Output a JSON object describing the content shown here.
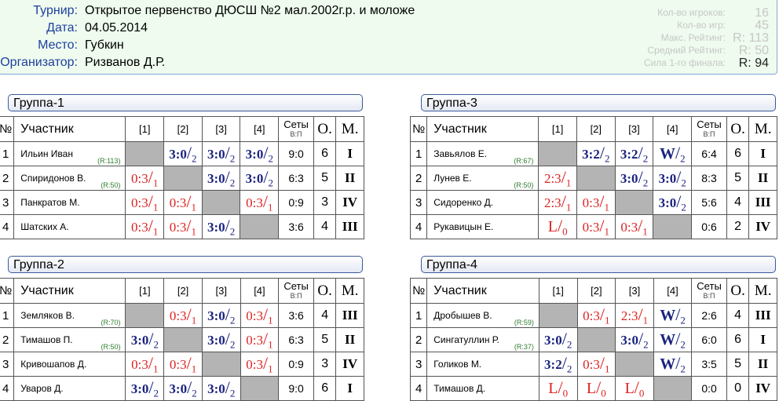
{
  "header": {
    "tournament_label": "Турнир:",
    "tournament": "Открытое первенство ДЮСШ №2 мал.2002г.р. и моложе",
    "date_label": "Дата:",
    "date": "04.05.2014",
    "place_label": "Место:",
    "place": "Губкин",
    "organizer_label": "Организатор:",
    "organizer": "Ризванов Д.Р."
  },
  "stats": {
    "players_label": "Кол-во игроков:",
    "players": "16",
    "games_label": "Кол-во игр:",
    "games": "45",
    "max_rating_label": "Макс. Рейтинг:",
    "max_rating": "R: 113",
    "avg_rating_label": "Средний Рейтинг:",
    "avg_rating": "R:  50",
    "final_strength_label": "Сила 1-го финала:",
    "final_strength": "R:  94"
  },
  "columns": {
    "num": "№",
    "participant": "Участник",
    "c1": "[1]",
    "c2": "[2]",
    "c3": "[3]",
    "c4": "[4]",
    "sets": "Сеты",
    "sets_sub": "В:П",
    "points": "О.",
    "place": "М."
  },
  "groups": [
    {
      "title": "Группа-1",
      "rows": [
        {
          "n": "1",
          "name": "Ильин Иван",
          "rating": "(R:113)",
          "r": [
            null,
            {
              "s": "3:0",
              "p": "2",
              "w": true
            },
            {
              "s": "3:0",
              "p": "2",
              "w": true
            },
            {
              "s": "3:0",
              "p": "2",
              "w": true
            }
          ],
          "sets": "9:0",
          "pts": "6",
          "place": "I"
        },
        {
          "n": "2",
          "name": "Спиридонов В.",
          "rating": "(R:50)",
          "r": [
            {
              "s": "0:3",
              "p": "1",
              "w": false
            },
            null,
            {
              "s": "3:0",
              "p": "2",
              "w": true
            },
            {
              "s": "3:0",
              "p": "2",
              "w": true
            }
          ],
          "sets": "6:3",
          "pts": "5",
          "place": "II"
        },
        {
          "n": "3",
          "name": "Панкратов М.",
          "rating": "",
          "r": [
            {
              "s": "0:3",
              "p": "1",
              "w": false
            },
            {
              "s": "0:3",
              "p": "1",
              "w": false
            },
            null,
            {
              "s": "0:3",
              "p": "1",
              "w": false
            }
          ],
          "sets": "0:9",
          "pts": "3",
          "place": "IV"
        },
        {
          "n": "4",
          "name": "Шатских А.",
          "rating": "",
          "r": [
            {
              "s": "0:3",
              "p": "1",
              "w": false
            },
            {
              "s": "0:3",
              "p": "1",
              "w": false
            },
            {
              "s": "3:0",
              "p": "2",
              "w": true
            },
            null
          ],
          "sets": "3:6",
          "pts": "4",
          "place": "III"
        }
      ]
    },
    {
      "title": "Группа-3",
      "rows": [
        {
          "n": "1",
          "name": "Завьялов Е.",
          "rating": "(R:67)",
          "r": [
            null,
            {
              "s": "3:2",
              "p": "2",
              "w": true
            },
            {
              "s": "3:2",
              "p": "2",
              "w": true
            },
            {
              "s": "W",
              "p": "2",
              "w": true
            }
          ],
          "sets": "6:4",
          "pts": "6",
          "place": "I"
        },
        {
          "n": "2",
          "name": "Лунев Е.",
          "rating": "(R:50)",
          "r": [
            {
              "s": "2:3",
              "p": "1",
              "w": false
            },
            null,
            {
              "s": "3:0",
              "p": "2",
              "w": true
            },
            {
              "s": "3:0",
              "p": "2",
              "w": true
            }
          ],
          "sets": "8:3",
          "pts": "5",
          "place": "II"
        },
        {
          "n": "3",
          "name": "Сидоренко Д.",
          "rating": "",
          "r": [
            {
              "s": "2:3",
              "p": "1",
              "w": false
            },
            {
              "s": "0:3",
              "p": "1",
              "w": false
            },
            null,
            {
              "s": "3:0",
              "p": "2",
              "w": true
            }
          ],
          "sets": "5:6",
          "pts": "4",
          "place": "III"
        },
        {
          "n": "4",
          "name": "Рукавицын Е.",
          "rating": "",
          "r": [
            {
              "s": "L",
              "p": "0",
              "w": false
            },
            {
              "s": "0:3",
              "p": "1",
              "w": false
            },
            {
              "s": "0:3",
              "p": "1",
              "w": false
            },
            null
          ],
          "sets": "0:6",
          "pts": "2",
          "place": "IV"
        }
      ]
    },
    {
      "title": "Группа-2",
      "rows": [
        {
          "n": "1",
          "name": "Земляков В.",
          "rating": "(R:70)",
          "r": [
            null,
            {
              "s": "0:3",
              "p": "1",
              "w": false
            },
            {
              "s": "3:0",
              "p": "2",
              "w": true
            },
            {
              "s": "0:3",
              "p": "1",
              "w": false
            }
          ],
          "sets": "3:6",
          "pts": "4",
          "place": "III"
        },
        {
          "n": "2",
          "name": "Тимашов П.",
          "rating": "(R:50)",
          "r": [
            {
              "s": "3:0",
              "p": "2",
              "w": true
            },
            null,
            {
              "s": "3:0",
              "p": "2",
              "w": true
            },
            {
              "s": "0:3",
              "p": "1",
              "w": false
            }
          ],
          "sets": "6:3",
          "pts": "5",
          "place": "II"
        },
        {
          "n": "3",
          "name": "Кривошапов Д.",
          "rating": "",
          "r": [
            {
              "s": "0:3",
              "p": "1",
              "w": false
            },
            {
              "s": "0:3",
              "p": "1",
              "w": false
            },
            null,
            {
              "s": "0:3",
              "p": "1",
              "w": false
            }
          ],
          "sets": "0:9",
          "pts": "3",
          "place": "IV"
        },
        {
          "n": "4",
          "name": "Уваров Д.",
          "rating": "",
          "r": [
            {
              "s": "3:0",
              "p": "2",
              "w": true
            },
            {
              "s": "3:0",
              "p": "2",
              "w": true
            },
            {
              "s": "3:0",
              "p": "2",
              "w": true
            },
            null
          ],
          "sets": "9:0",
          "pts": "6",
          "place": "I"
        }
      ]
    },
    {
      "title": "Группа-4",
      "rows": [
        {
          "n": "1",
          "name": "Дробышев В.",
          "rating": "(R:59)",
          "r": [
            null,
            {
              "s": "0:3",
              "p": "1",
              "w": false
            },
            {
              "s": "2:3",
              "p": "1",
              "w": false
            },
            {
              "s": "W",
              "p": "2",
              "w": true
            }
          ],
          "sets": "2:6",
          "pts": "4",
          "place": "III"
        },
        {
          "n": "2",
          "name": "Сингатуллин Р.",
          "rating": "(R:37)",
          "r": [
            {
              "s": "3:0",
              "p": "2",
              "w": true
            },
            null,
            {
              "s": "3:0",
              "p": "2",
              "w": true
            },
            {
              "s": "W",
              "p": "2",
              "w": true
            }
          ],
          "sets": "6:0",
          "pts": "6",
          "place": "I"
        },
        {
          "n": "3",
          "name": "Голиков М.",
          "rating": "",
          "r": [
            {
              "s": "3:2",
              "p": "2",
              "w": true
            },
            {
              "s": "0:3",
              "p": "1",
              "w": false
            },
            null,
            {
              "s": "W",
              "p": "2",
              "w": true
            }
          ],
          "sets": "3:5",
          "pts": "5",
          "place": "II"
        },
        {
          "n": "4",
          "name": "Тимашов Д.",
          "rating": "",
          "r": [
            {
              "s": "L",
              "p": "0",
              "w": false
            },
            {
              "s": "L",
              "p": "0",
              "w": false
            },
            {
              "s": "L",
              "p": "0",
              "w": false
            },
            null
          ],
          "sets": "0:0",
          "pts": "0",
          "place": "IV"
        }
      ]
    }
  ]
}
